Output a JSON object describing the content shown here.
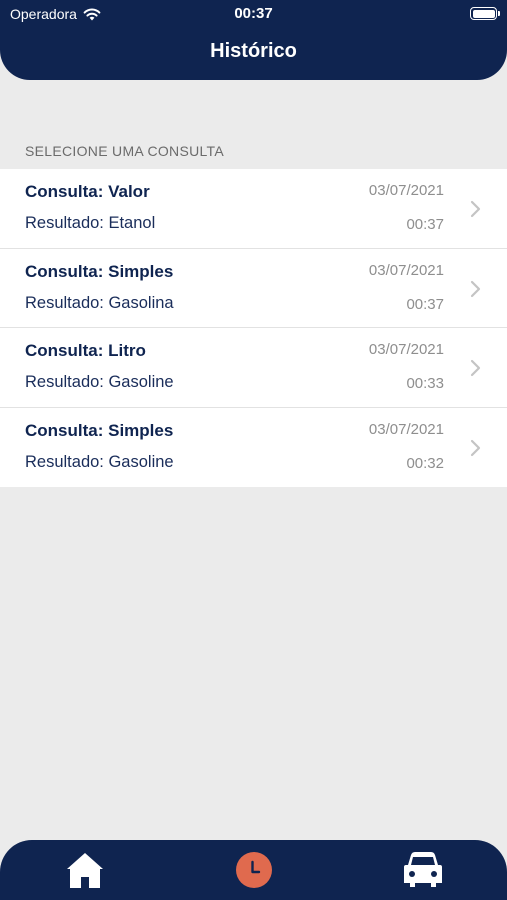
{
  "status_bar": {
    "carrier": "Operadora",
    "time": "00:37"
  },
  "header": {
    "title": "Histórico"
  },
  "section": {
    "label": "SELECIONE UMA CONSULTA"
  },
  "history": [
    {
      "title": "Consulta: Valor",
      "result": "Resultado: Etanol",
      "date": "03/07/2021",
      "time": "00:37"
    },
    {
      "title": "Consulta: Simples",
      "result": "Resultado: Gasolina",
      "date": "03/07/2021",
      "time": "00:37"
    },
    {
      "title": "Consulta: Litro",
      "result": "Resultado: Gasoline",
      "date": "03/07/2021",
      "time": "00:33"
    },
    {
      "title": "Consulta: Simples",
      "result": "Resultado: Gasoline",
      "date": "03/07/2021",
      "time": "00:32"
    }
  ],
  "tabbar": {
    "tabs": [
      {
        "icon": "home-icon",
        "active": false
      },
      {
        "icon": "clock-icon",
        "active": true
      },
      {
        "icon": "car-icon",
        "active": false
      }
    ]
  },
  "colors": {
    "primary": "#0f2450",
    "accent": "#e06a4e",
    "background": "#ebebeb"
  }
}
